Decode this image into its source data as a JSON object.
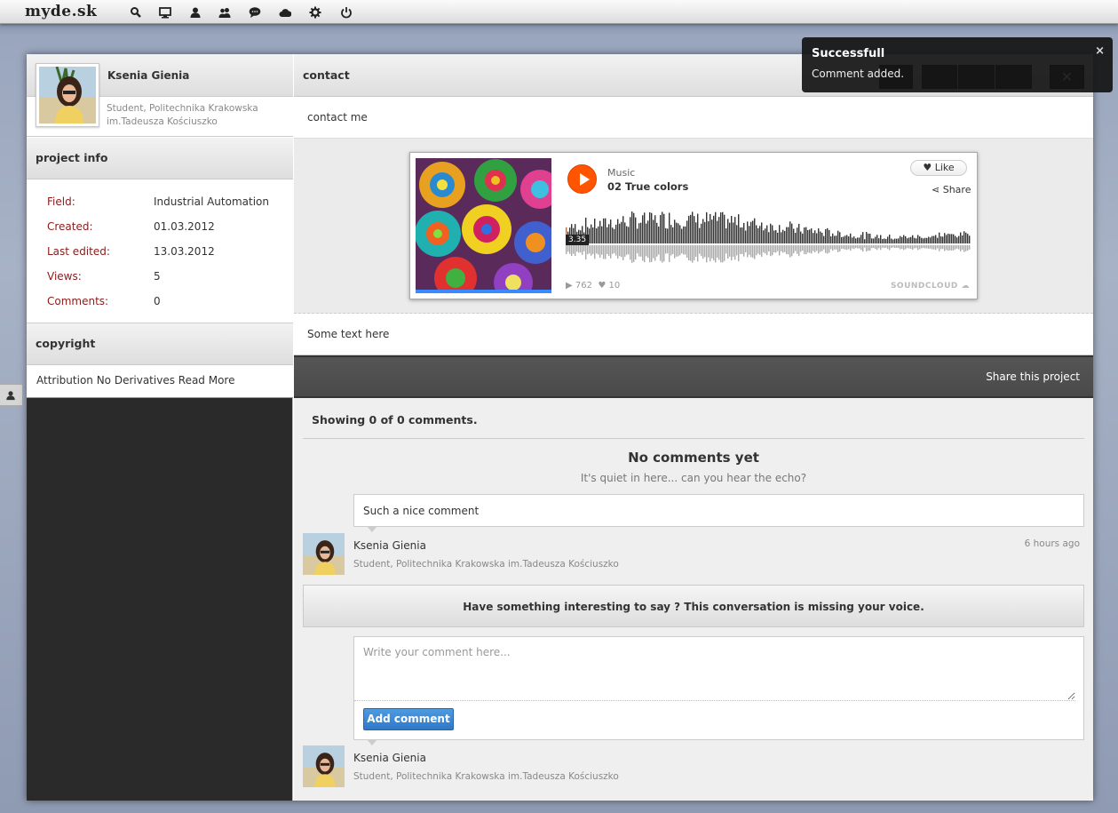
{
  "app": {
    "logo": "myde.sk"
  },
  "topbar": {
    "icons": [
      "search-icon",
      "monitor-icon",
      "user-icon",
      "users-icon",
      "chat-icon",
      "cloud-icon",
      "gear-icon",
      "power-icon"
    ]
  },
  "profile": {
    "name": "Ksenia Gienia",
    "subtitle_line1": "Student, Politechnika Krakowska",
    "subtitle_line2": "im.Tadeusza Kościuszko"
  },
  "project_info": {
    "title": "project info",
    "rows": [
      {
        "key": "Field:",
        "value": "Industrial Automation"
      },
      {
        "key": "Created:",
        "value": "01.03.2012"
      },
      {
        "key": "Last edited:",
        "value": "13.03.2012"
      },
      {
        "key": "Views:",
        "value": "5"
      },
      {
        "key": "Comments:",
        "value": "0"
      }
    ]
  },
  "copyright": {
    "title": "copyright",
    "text": "Attribution No Derivatives Read More"
  },
  "main": {
    "title": "contact",
    "contact_text": "contact me",
    "some_text": "Some text here",
    "share_label": "Share this project"
  },
  "player": {
    "genre": "Music",
    "track": "02 True colors",
    "like_label": "Like",
    "share_label": "Share",
    "time": "3.35",
    "plays": "762",
    "likes": "10",
    "brand": "SOUNDCLOUD",
    "accent": "#ff5500"
  },
  "comments": {
    "showing": "Showing 0 of 0 comments.",
    "empty_title": "No comments yet",
    "empty_sub": "It's quiet in here... can you hear the echo?",
    "items": [
      {
        "text": "Such a nice comment",
        "author": "Ksenia Gienia",
        "author_sub": "Student, Politechnika Krakowska im.Tadeusza Kościuszko",
        "time": "6 hours ago"
      }
    ],
    "prompt": "Have something interesting to say ? This conversation is missing your voice.",
    "form": {
      "placeholder": "Write your comment here...",
      "button": "Add comment",
      "author": "Ksenia Gienia",
      "author_sub": "Student, Politechnika Krakowska im.Tadeusza Kościuszko"
    }
  },
  "toast": {
    "title": "Successfull",
    "message": "Comment added.",
    "close": "×"
  },
  "toolbar": {
    "close": "✕"
  }
}
